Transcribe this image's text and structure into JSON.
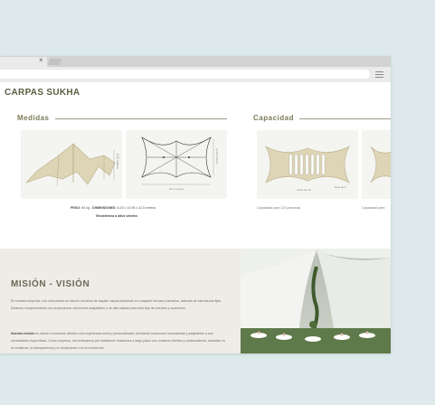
{
  "browser": {
    "close_glyph": "×",
    "menu_icon": "hamburger-menu-icon"
  },
  "site": {
    "title": "CARPAS SUKHA"
  },
  "sections": {
    "medidas": {
      "heading": "Medidas"
    },
    "capacidad": {
      "heading": "Capacidad"
    }
  },
  "specs": {
    "weight_label": "PESO:",
    "weight_value": " 95 kg - ",
    "dims_label": "DIMENSIONES:",
    "dims_value": " 6.25 x 14.95 x 22.5 metros",
    "wind_note": "Resistencia a altos vientos"
  },
  "diagram_labels": {
    "height": "6.25 metros",
    "width": "14.95 metros",
    "length": "22.5 metros"
  },
  "capacity": {
    "caption1": "Capacidad para 122 personas",
    "caption2": "Capacidad para",
    "label_mesa": "mesa de 10",
    "label_area": "área de 5"
  },
  "mission": {
    "title": "MISIÓN - VISIÓN",
    "p1": "En nuestra empresa, nos enfocamos en ofrecer servicios de alquiler carpas beduinas en cualquier formas y tamaños, además de estructuras fijas. Estamos comprometidos con proporcionar soluciones adaptables y de alta calidad para todo tipo de eventos y ocasiones.",
    "p2_bold": "Nuestra misión",
    "p2": " es ofrecer a nuestros clientes una experiencia única y personalizada, brindando soluciones innovadoras y adaptables a sus necesidades específicas. Como empresa, nos enfocamos por establecer relaciones a largo plazo con nuestros clientes y colaboradores, basadas en la confianza, la transparencia y el compromiso con la excelencia."
  },
  "colors": {
    "page_bg": "#dde9ea",
    "heading": "#7b7a58",
    "tent_fill": "#ddd5b5",
    "mission_bg": "#eeece7"
  }
}
